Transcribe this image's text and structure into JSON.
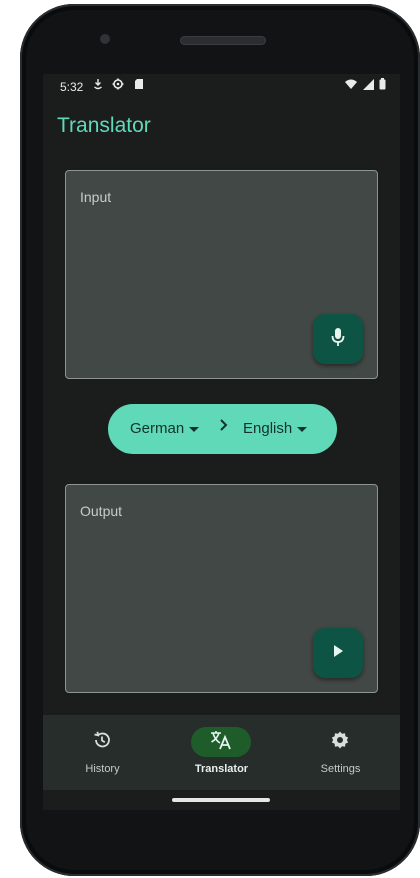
{
  "status_bar": {
    "time": "5:32",
    "left_icons": [
      "data-saver-icon",
      "settings-gear-icon",
      "sd-card-icon"
    ],
    "right_icons": [
      "wifi-icon",
      "cellular-signal-icon",
      "battery-icon"
    ]
  },
  "app": {
    "title": "Translator"
  },
  "input_panel": {
    "label": "Input",
    "button_icon": "microphone-icon"
  },
  "language_selector": {
    "source": "German",
    "target": "English",
    "separator_icon": "chevron-right-icon"
  },
  "output_panel": {
    "label": "Output",
    "button_icon": "play-icon"
  },
  "bottom_nav": {
    "items": [
      {
        "label": "History",
        "icon": "history-icon",
        "selected": false
      },
      {
        "label": "Translator",
        "icon": "translate-icon",
        "selected": true
      },
      {
        "label": "Settings",
        "icon": "gear-icon",
        "selected": false
      }
    ]
  },
  "colors": {
    "accent": "#5fd9b8",
    "background": "#1b1d1d",
    "panel": "#424845",
    "fab": "#0e5444",
    "nav_background": "#272d2b",
    "nav_selected_indicator": "#1e5c2a"
  }
}
